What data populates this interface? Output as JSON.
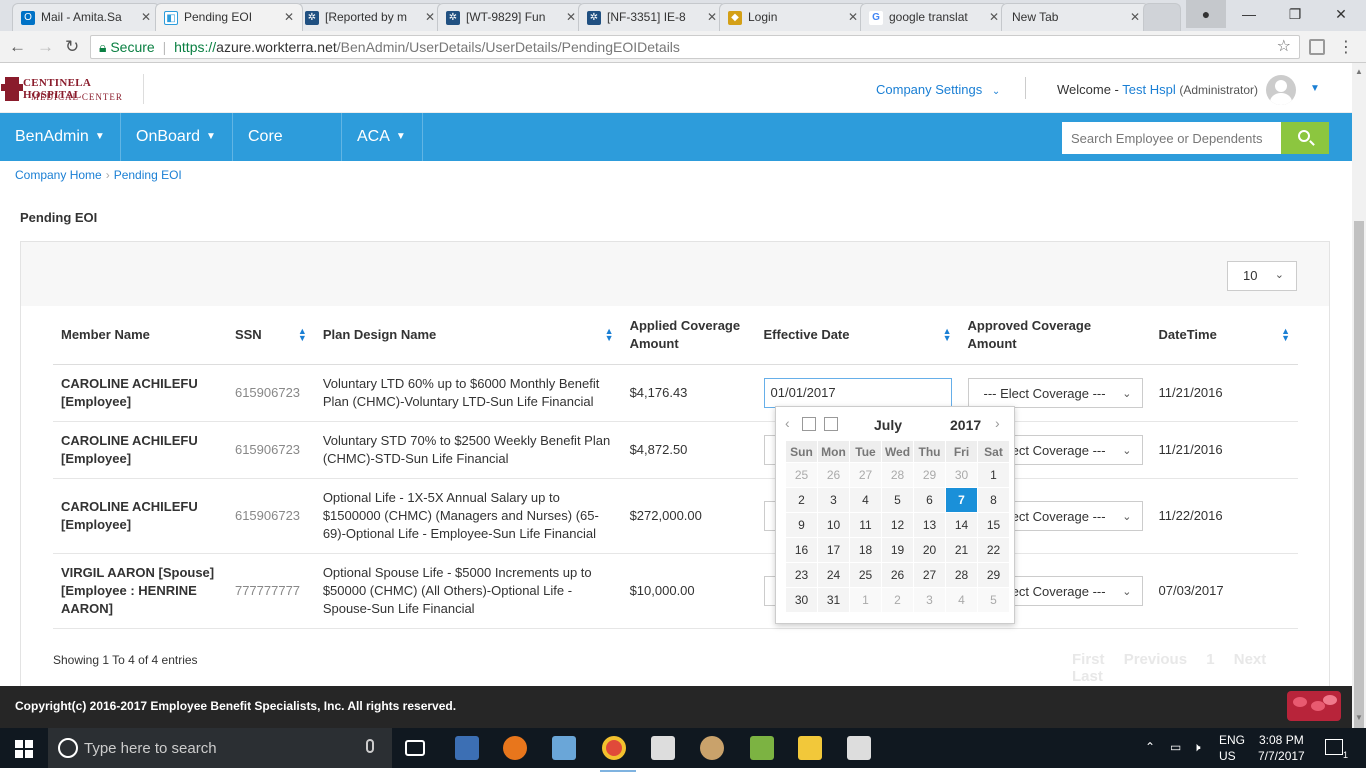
{
  "browser": {
    "tabs": [
      {
        "label": "Mail - Amita.Sa",
        "icon": "outlook-icon",
        "color": "#0072c6"
      },
      {
        "label": "Pending EOI",
        "icon": "site-icon",
        "color": "#2d9cdb"
      },
      {
        "label": "[Reported by m",
        "icon": "jira-icon",
        "color": "#205081"
      },
      {
        "label": "[WT-9829] Fun",
        "icon": "jira-icon",
        "color": "#205081"
      },
      {
        "label": "[NF-3351] IE-8",
        "icon": "jira-icon",
        "color": "#205081"
      },
      {
        "label": "Login",
        "icon": "login-icon",
        "color": "#d4a017"
      },
      {
        "label": "google translat",
        "icon": "google-icon",
        "color": "#4285f4"
      },
      {
        "label": "New Tab",
        "icon": "",
        "color": ""
      }
    ],
    "secure_label": "Secure",
    "url_scheme": "https://",
    "url_host": "azure.workterra.net",
    "url_path": "/BenAdmin/UserDetails/UserDetails/PendingEOIDetails"
  },
  "header": {
    "logo_line1": "CENTINELA HOSPITAL",
    "logo_line2": "MEDICAL  CENTER",
    "company_settings": "Company Settings",
    "welcome": "Welcome - ",
    "user": "Test Hspl",
    "role": "(Administrator)"
  },
  "nav": {
    "items": [
      "BenAdmin",
      "OnBoard",
      "Core HR",
      "ACA"
    ],
    "search_placeholder": "Search Employee or Dependents"
  },
  "breadcrumb": {
    "home": "Company Home",
    "current": "Pending EOI"
  },
  "page_title": "Pending EOI",
  "page_size": "10",
  "table": {
    "columns": [
      "Member Name",
      "SSN",
      "Plan Design Name",
      "Applied Coverage Amount",
      "Effective Date",
      "Approved Coverage Amount",
      "DateTime"
    ],
    "rows": [
      {
        "member": "CAROLINE ACHILEFU [Employee]",
        "ssn": "615906723",
        "plan": "Voluntary LTD 60% up to $6000 Monthly Benefit Plan (CHMC)-Voluntary LTD-Sun Life Financial",
        "applied": "$4,176.43",
        "effective": "01/01/2017",
        "approved": "--- Elect Coverage ---",
        "datetime": "11/21/2016"
      },
      {
        "member": "CAROLINE ACHILEFU [Employee]",
        "ssn": "615906723",
        "plan": "Voluntary STD 70% to $2500 Weekly Benefit Plan (CHMC)-STD-Sun Life Financial",
        "applied": "$4,872.50",
        "effective": "",
        "approved": "--- Elect Coverage ---",
        "datetime": "11/21/2016"
      },
      {
        "member": "CAROLINE ACHILEFU [Employee]",
        "ssn": "615906723",
        "plan": "Optional Life - 1X-5X Annual Salary up to $1500000 (CHMC) (Managers and Nurses) (65-69)-Optional Life - Employee-Sun Life Financial",
        "applied": "$272,000.00",
        "effective": "",
        "approved": "--- Elect Coverage ---",
        "datetime": "11/22/2016"
      },
      {
        "member": "VIRGIL AARON [Spouse] [Employee : HENRINE AARON]",
        "ssn": "777777777",
        "plan": "Optional Spouse Life - $5000 Increments up to $50000 (CHMC) (All Others)-Optional Life - Spouse-Sun Life Financial",
        "applied": "$10,000.00",
        "effective": "",
        "approved": "--- Elect Coverage ---",
        "datetime": "07/03/2017"
      }
    ]
  },
  "showing": "Showing 1 To 4 of 4 entries",
  "pager": {
    "first": "First",
    "previous": "Previous",
    "page": "1",
    "next": "Next",
    "last": "Last"
  },
  "datepicker": {
    "month": "July",
    "year": "2017",
    "weekdays": [
      "Sun",
      "Mon",
      "Tue",
      "Wed",
      "Thu",
      "Fri",
      "Sat"
    ],
    "weeks": [
      [
        "25",
        "26",
        "27",
        "28",
        "29",
        "30",
        "1"
      ],
      [
        "2",
        "3",
        "4",
        "5",
        "6",
        "7",
        "8"
      ],
      [
        "9",
        "10",
        "11",
        "12",
        "13",
        "14",
        "15"
      ],
      [
        "16",
        "17",
        "18",
        "19",
        "20",
        "21",
        "22"
      ],
      [
        "23",
        "24",
        "25",
        "26",
        "27",
        "28",
        "29"
      ],
      [
        "30",
        "31",
        "1",
        "2",
        "3",
        "4",
        "5"
      ]
    ],
    "selected": "7"
  },
  "footer": {
    "copyright": "Copyright(c) 2016-2017 Employee Benefit Specialists, Inc. All rights reserved."
  },
  "taskbar": {
    "search_placeholder": "Type here to search",
    "lang1": "ENG",
    "lang2": "US",
    "time": "3:08 PM",
    "date": "7/7/2017",
    "notifications": "1"
  },
  "colors": {
    "nav": "#2d9cdb",
    "search_button": "#8cc63f",
    "link": "#1a7fd4",
    "selected_day": "#1a90d9",
    "footer": "#262626"
  }
}
